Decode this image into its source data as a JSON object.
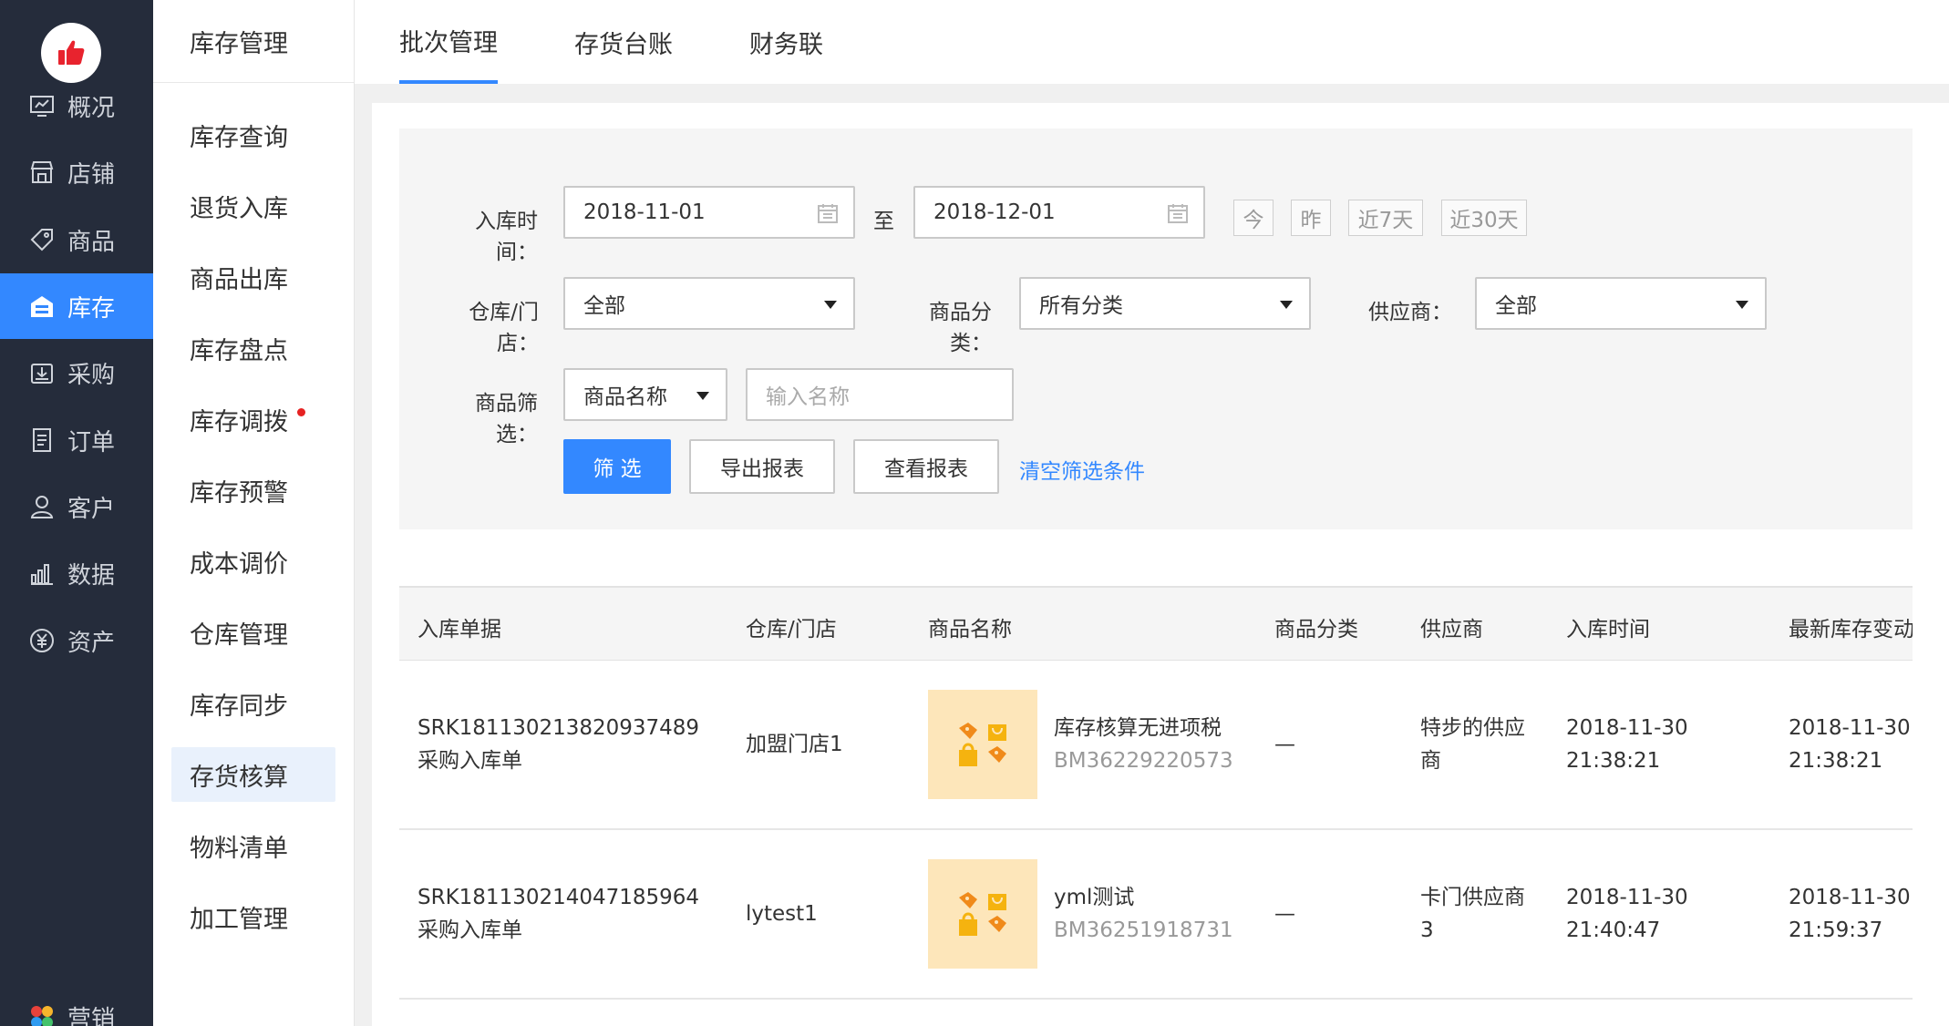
{
  "nav": {
    "items": [
      {
        "label": "概况",
        "icon": "dashboard-icon"
      },
      {
        "label": "店铺",
        "icon": "store-icon"
      },
      {
        "label": "商品",
        "icon": "tag-icon"
      },
      {
        "label": "库存",
        "icon": "inventory-icon"
      },
      {
        "label": "采购",
        "icon": "purchase-icon"
      },
      {
        "label": "订单",
        "icon": "order-icon"
      },
      {
        "label": "客户",
        "icon": "customer-icon"
      },
      {
        "label": "数据",
        "icon": "chart-icon"
      },
      {
        "label": "资产",
        "icon": "yuan-icon"
      },
      {
        "label": "营销",
        "icon": "marketing-icon"
      }
    ],
    "active_index": 3,
    "active_color": "#3388ff"
  },
  "subnav": {
    "title": "库存管理",
    "items": [
      "库存查询",
      "退货入库",
      "商品出库",
      "库存盘点",
      "库存调拨",
      "库存预警",
      "成本调价",
      "仓库管理",
      "库存同步",
      "存货核算",
      "物料清单",
      "加工管理"
    ],
    "active": "存货核算",
    "badge_item": "库存调拨"
  },
  "tabs": [
    "批次管理",
    "存货台账",
    "财务联"
  ],
  "filter": {
    "date_label": "入库时间：",
    "date_from": "2018-11-01",
    "date_sep": "至",
    "date_to": "2018-12-01",
    "quick": [
      "今",
      "昨",
      "近7天",
      "近30天"
    ],
    "warehouse_label": "仓库/门店：",
    "warehouse_value": "全部",
    "category_label": "商品分类：",
    "category_value": "所有分类",
    "supplier_label": "供应商：",
    "supplier_value": "全部",
    "goods_label": "商品筛选：",
    "goods_type": "商品名称",
    "goods_placeholder": "输入名称",
    "btn_filter": "筛 选",
    "btn_export": "导出报表",
    "btn_view": "查看报表",
    "clear": "清空筛选条件"
  },
  "table": {
    "headers": [
      "入库单据",
      "仓库/门店",
      "商品名称",
      "商品分类",
      "供应商",
      "入库时间",
      "最新库存变动"
    ],
    "rows": [
      {
        "doc_no": "SRK181130213820937489",
        "doc_type": "采购入库单",
        "store": "加盟门店1",
        "goods_name": "库存核算无进项税",
        "goods_code": "BM36229220573",
        "category": "—",
        "supplier_l1": "特步的供应",
        "supplier_l2": "商",
        "in_date": "2018-11-30",
        "in_time": "21:38:21",
        "chg_date": "2018-11-30",
        "chg_time": "21:38:21"
      },
      {
        "doc_no": "SRK181130214047185964",
        "doc_type": "采购入库单",
        "store": "lytest1",
        "goods_name": "yml测试",
        "goods_code": "BM36251918731",
        "category": "—",
        "supplier_l1": "卡门供应商",
        "supplier_l2": "3",
        "in_date": "2018-11-30",
        "in_time": "21:40:47",
        "chg_date": "2018-11-30",
        "chg_time": "21:59:37"
      }
    ]
  }
}
